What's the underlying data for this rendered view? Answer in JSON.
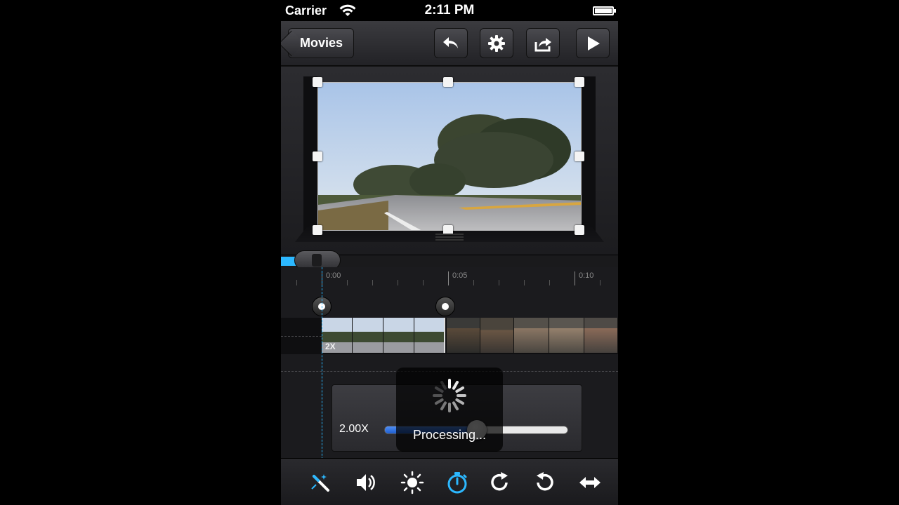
{
  "status_bar": {
    "carrier": "Carrier",
    "time": "2:11 PM"
  },
  "nav": {
    "back_label": "Movies"
  },
  "timeline": {
    "ticks": [
      {
        "label": "0:00"
      },
      {
        "label": "0:05"
      },
      {
        "label": "0:10"
      }
    ],
    "speed_tag": "2X",
    "scrub_progress": 0.11
  },
  "speed_panel": {
    "value": "2.00X",
    "slider_fraction": 0.5
  },
  "hud": {
    "message": "Processing..."
  },
  "colors": {
    "accent": "#2cb8ff",
    "slider": "#2f6fe0"
  },
  "toolbar": {
    "tools": [
      "magic-wand-icon",
      "volume-icon",
      "brightness-icon",
      "speed-timer-icon",
      "rotate-clockwise-icon",
      "rotate-counterclockwise-icon",
      "flip-horizontal-icon"
    ],
    "active": "speed-timer-icon"
  }
}
